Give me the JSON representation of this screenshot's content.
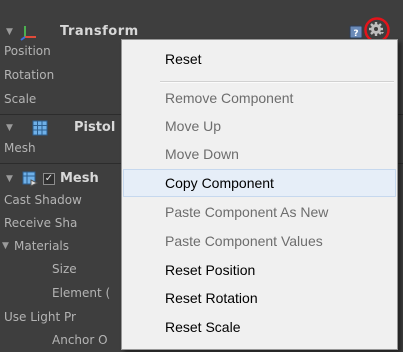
{
  "inspector": {
    "transform": {
      "title": "Transform",
      "fields": [
        "Position",
        "Rotation",
        "Scale"
      ]
    },
    "mesh_filter": {
      "title": "Pistol",
      "fields": [
        "Mesh"
      ]
    },
    "mesh_renderer": {
      "title": "Mesh",
      "fields": {
        "cast_shadows": "Cast Shadow",
        "receive_shadows": "Receive Sha",
        "materials": "Materials",
        "size": "Size",
        "element": "Element (",
        "use_light_probes": "Use Light Pr",
        "anchor": "Anchor O"
      }
    }
  },
  "context_menu": {
    "items": [
      {
        "label": "Reset",
        "enabled": true
      },
      {
        "label": "Remove Component",
        "enabled": false
      },
      {
        "label": "Move Up",
        "enabled": false
      },
      {
        "label": "Move Down",
        "enabled": false
      },
      {
        "label": "Copy Component",
        "enabled": true,
        "hovered": true
      },
      {
        "label": "Paste Component As New",
        "enabled": false
      },
      {
        "label": "Paste Component Values",
        "enabled": false
      },
      {
        "label": "Reset Position",
        "enabled": true
      },
      {
        "label": "Reset Rotation",
        "enabled": true
      },
      {
        "label": "Reset Scale",
        "enabled": true
      }
    ]
  },
  "colors": {
    "panel_bg": "#3e3e3e",
    "menu_bg": "#f0f0f0",
    "highlight_circle": "#e3141b",
    "hover_bg": "#e6eef8"
  },
  "icons": {
    "transform": "axes-icon",
    "mesh_filter": "grid-icon",
    "mesh_renderer": "mesh-renderer-icon",
    "settings": "gear-icon",
    "help": "help-book-icon",
    "fold": "triangle-down-icon"
  }
}
